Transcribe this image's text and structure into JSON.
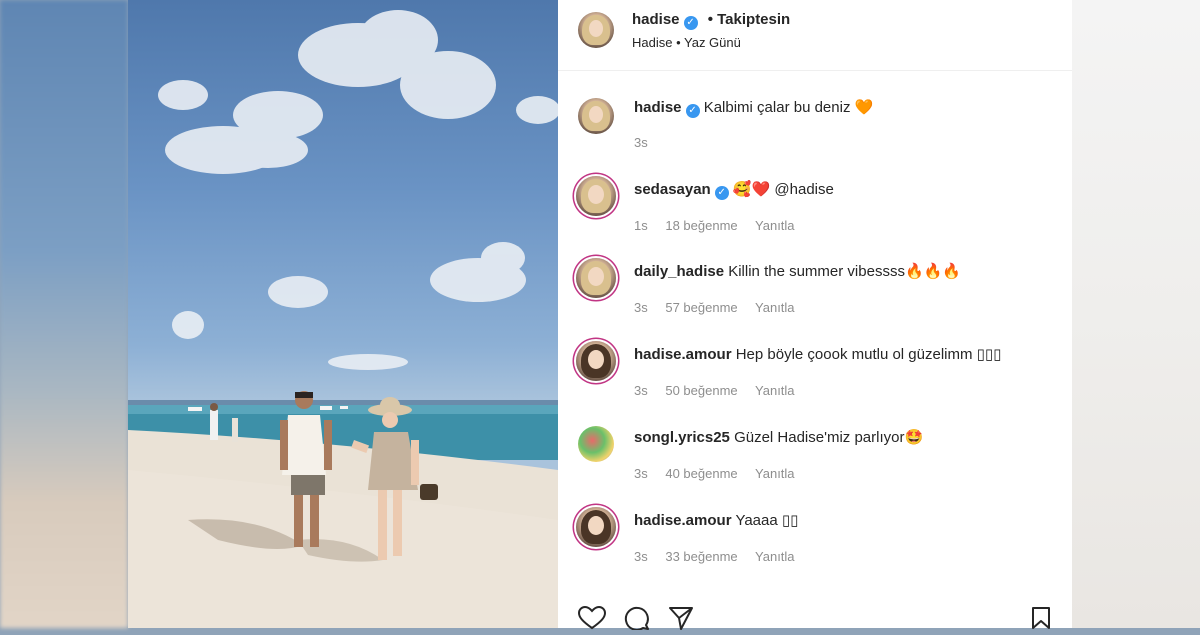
{
  "post": {
    "username": "hadise",
    "follow_label": "Takiptesin",
    "subtitle": "Hadise • Yaz Günü",
    "caption_user": "hadise",
    "caption_text": "Kalbimi çalar bu deniz",
    "caption_emoji": "🧡",
    "caption_time": "3s"
  },
  "comments": [
    {
      "user": "sedasayan",
      "verified": "✓",
      "text": "🥰❤️ @hadise",
      "time": "1s",
      "likes": "18 beğenme",
      "reply": "Yanıtla"
    },
    {
      "user": "daily_hadise",
      "verified": "",
      "text": "Killin the summer vibessss🔥🔥🔥",
      "time": "3s",
      "likes": "57 beğenme",
      "reply": "Yanıtla"
    },
    {
      "user": "hadise.amour",
      "verified": "",
      "text": "Hep böyle çoook mutlu ol güzelimm ▯▯▯",
      "time": "3s",
      "likes": "50 beğenme",
      "reply": "Yanıtla"
    },
    {
      "user": "songl.yrics25",
      "verified": "",
      "text": "Güzel Hadise'miz parlıyor🤩",
      "time": "3s",
      "likes": "40 beğenme",
      "reply": "Yanıtla"
    },
    {
      "user": "hadise.amour",
      "verified": "",
      "text": "Yaaaa ▯▯",
      "time": "3s",
      "likes": "33 beğenme",
      "reply": "Yanıtla"
    }
  ],
  "icons": {
    "like": "heart-icon",
    "comment": "comment-icon",
    "share": "send-icon",
    "save": "bookmark-icon"
  },
  "colors": {
    "verified": "#3897f0",
    "meta_text": "#8e8e8e",
    "primary_text": "#262626"
  }
}
